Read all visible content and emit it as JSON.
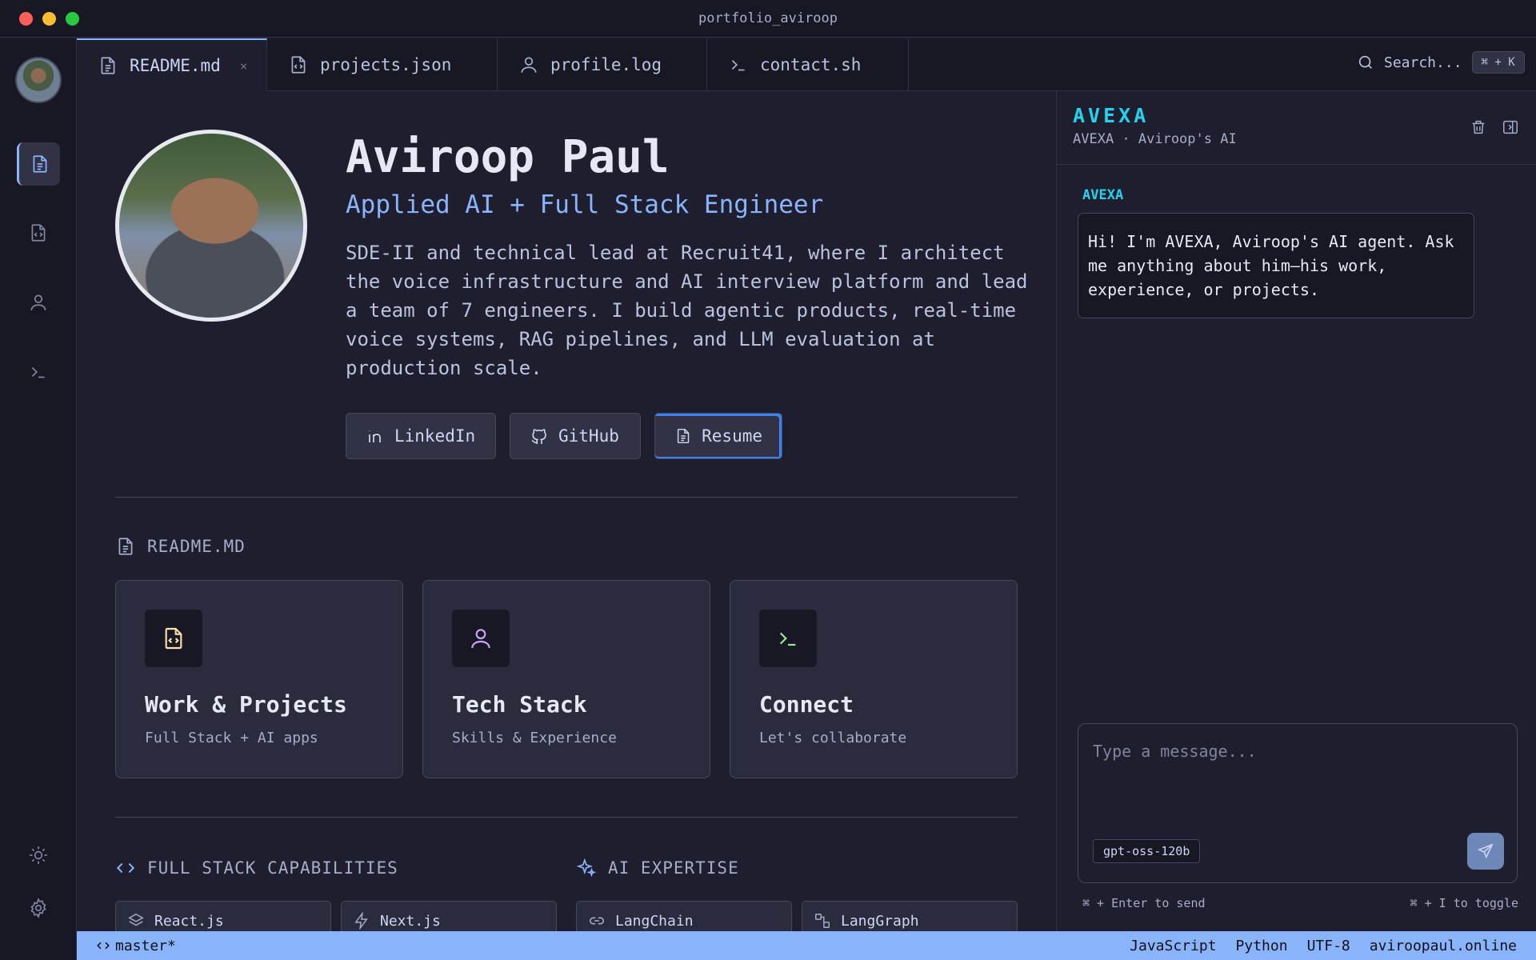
{
  "window": {
    "title": "portfolio_aviroop"
  },
  "colors": {
    "accent": "#89b4fa",
    "cyan": "#22d3ee",
    "bg": "#1e1e2e",
    "status_bar": "#89b4fa"
  },
  "tabs": [
    {
      "label": "README.md",
      "icon": "file-text-icon",
      "close": "×"
    },
    {
      "label": "projects.json",
      "icon": "file-code-icon"
    },
    {
      "label": "profile.log",
      "icon": "user-icon"
    },
    {
      "label": "contact.sh",
      "icon": "terminal-icon"
    }
  ],
  "search": {
    "label": "Search...",
    "shortcut": "⌘ + K"
  },
  "profile": {
    "name": "Aviroop Paul",
    "role": "Applied AI + Full Stack Engineer",
    "bio": "SDE-II and technical lead at Recruit41, where I architect the voice infrastructure and AI interview platform and lead a team of 7 engineers. I build agentic products, real-time voice systems, RAG pipelines, and LLM evaluation at production scale."
  },
  "links": {
    "linkedin": "LinkedIn",
    "github": "GitHub",
    "resume": "Resume"
  },
  "readme": {
    "title": "README.MD",
    "cards": [
      {
        "title": "Work & Projects",
        "subtitle": "Full Stack + AI apps",
        "icon": "file-code-icon"
      },
      {
        "title": "Tech Stack",
        "subtitle": "Skills & Experience",
        "icon": "user-icon"
      },
      {
        "title": "Connect",
        "subtitle": "Let's collaborate",
        "icon": "terminal-icon"
      }
    ]
  },
  "capabilities": {
    "fullstack_title": "FULL STACK CAPABILITIES",
    "ai_title": "AI EXPERTISE",
    "fullstack_items": [
      "React.js",
      "Next.js"
    ],
    "ai_items": [
      "LangChain",
      "LangGraph"
    ]
  },
  "chat": {
    "brand": "AVEXA",
    "subtitle": "AVEXA · Aviroop's AI",
    "message_author": "AVEXA",
    "message": "Hi! I'm AVEXA, Aviroop's AI agent. Ask me anything about him—his work, experience, or projects.",
    "placeholder": "Type a message...",
    "model": "gpt-oss-120b",
    "hint_send": "⌘ + Enter to send",
    "hint_toggle": "⌘ + I to toggle"
  },
  "status_bar": {
    "branch": "master*",
    "items": [
      "JavaScript",
      "Python",
      "UTF-8",
      "aviroopaul.online"
    ]
  }
}
